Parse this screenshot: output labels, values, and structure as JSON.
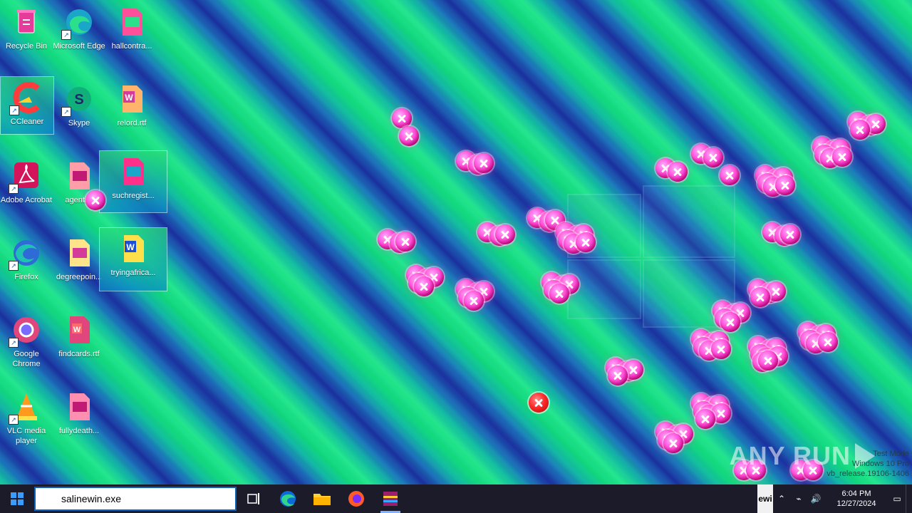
{
  "desktop": {
    "icons": [
      {
        "label": "Recycle Bin",
        "icon": "recycle-bin-icon"
      },
      {
        "label": "Microsoft Edge",
        "icon": "edge-icon"
      },
      {
        "label": "hallcontra...",
        "icon": "image-file-icon"
      },
      {
        "label": "CCleaner",
        "icon": "ccleaner-icon"
      },
      {
        "label": "Skype",
        "icon": "skype-icon"
      },
      {
        "label": "relord.rtf",
        "icon": "word-doc-icon"
      },
      {
        "label": "Adobe Acrobat",
        "icon": "acrobat-icon"
      },
      {
        "label": "agenti...",
        "icon": "image-file-icon"
      },
      {
        "label": "suchregist...",
        "icon": "image-file-icon"
      },
      {
        "label": "Firefox",
        "icon": "firefox-icon"
      },
      {
        "label": "degreepoin...",
        "icon": "image-file-icon"
      },
      {
        "label": "tryingafrica...",
        "icon": "word-doc-icon"
      },
      {
        "label": "Google Chrome",
        "icon": "chrome-icon"
      },
      {
        "label": "findcards.rtf",
        "icon": "word-doc-icon"
      },
      {
        "label": "VLC media player",
        "icon": "vlc-icon"
      },
      {
        "label": "fullydeath...",
        "icon": "image-file-icon"
      }
    ],
    "watermark": "ANY RUN",
    "build_info": [
      "Test Mode",
      "Windows 10 Pro",
      "vb_release.19106-1406"
    ]
  },
  "taskbar": {
    "search_value": "salinewin.exe",
    "tray_stub": "ewi",
    "clock_time": "6:04 PM",
    "clock_date": "12/27/2024"
  },
  "colors": {
    "taskbar": "#1b1b2a",
    "search_border": "#0a63b8",
    "error_bubble": "#ff4fd8"
  }
}
